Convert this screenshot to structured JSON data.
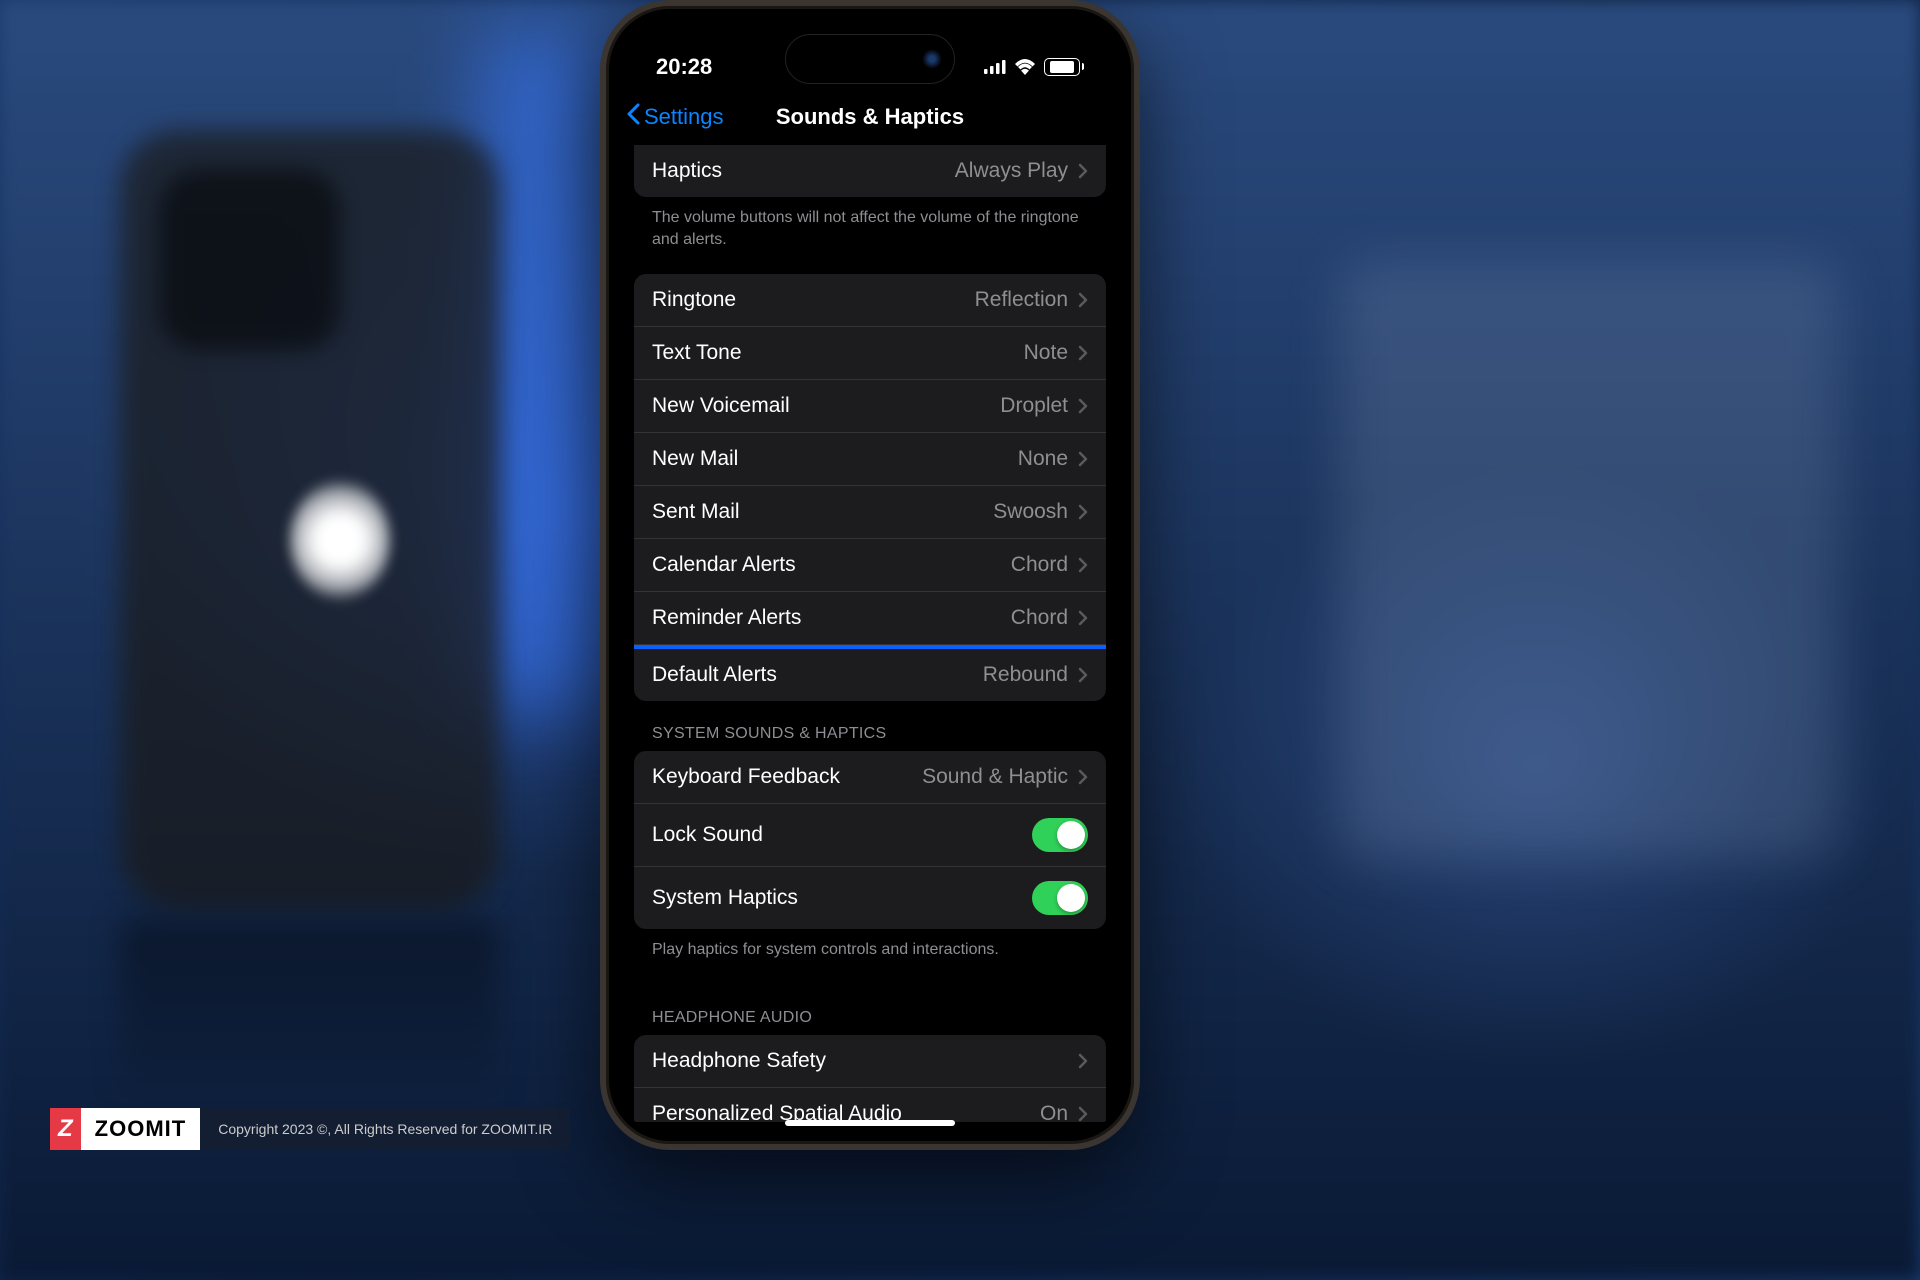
{
  "status": {
    "time": "20:28",
    "battery": "80"
  },
  "nav": {
    "back_label": "Settings",
    "title": "Sounds & Haptics"
  },
  "haptics_row": {
    "label": "Haptics",
    "value": "Always Play"
  },
  "haptics_footer": "The volume buttons will not affect the volume of the ringtone and alerts.",
  "sounds": {
    "ringtone": {
      "label": "Ringtone",
      "value": "Reflection"
    },
    "text_tone": {
      "label": "Text Tone",
      "value": "Note"
    },
    "new_voicemail": {
      "label": "New Voicemail",
      "value": "Droplet"
    },
    "new_mail": {
      "label": "New Mail",
      "value": "None"
    },
    "sent_mail": {
      "label": "Sent Mail",
      "value": "Swoosh"
    },
    "calendar_alerts": {
      "label": "Calendar Alerts",
      "value": "Chord"
    },
    "reminder_alerts": {
      "label": "Reminder Alerts",
      "value": "Chord"
    },
    "default_alerts": {
      "label": "Default Alerts",
      "value": "Rebound"
    }
  },
  "system_header": "SYSTEM SOUNDS & HAPTICS",
  "system": {
    "keyboard_feedback": {
      "label": "Keyboard Feedback",
      "value": "Sound & Haptic"
    },
    "lock_sound": {
      "label": "Lock Sound"
    },
    "system_haptics": {
      "label": "System Haptics"
    }
  },
  "system_footer": "Play haptics for system controls and interactions.",
  "headphone_header": "HEADPHONE AUDIO",
  "headphone": {
    "safety": {
      "label": "Headphone Safety"
    },
    "spatial": {
      "label": "Personalized Spatial Audio",
      "value": "On"
    }
  },
  "watermark": {
    "brand": "ZOOMIT",
    "copyright": "Copyright 2023 ©, All Rights Reserved for ZOOMIT.IR"
  }
}
